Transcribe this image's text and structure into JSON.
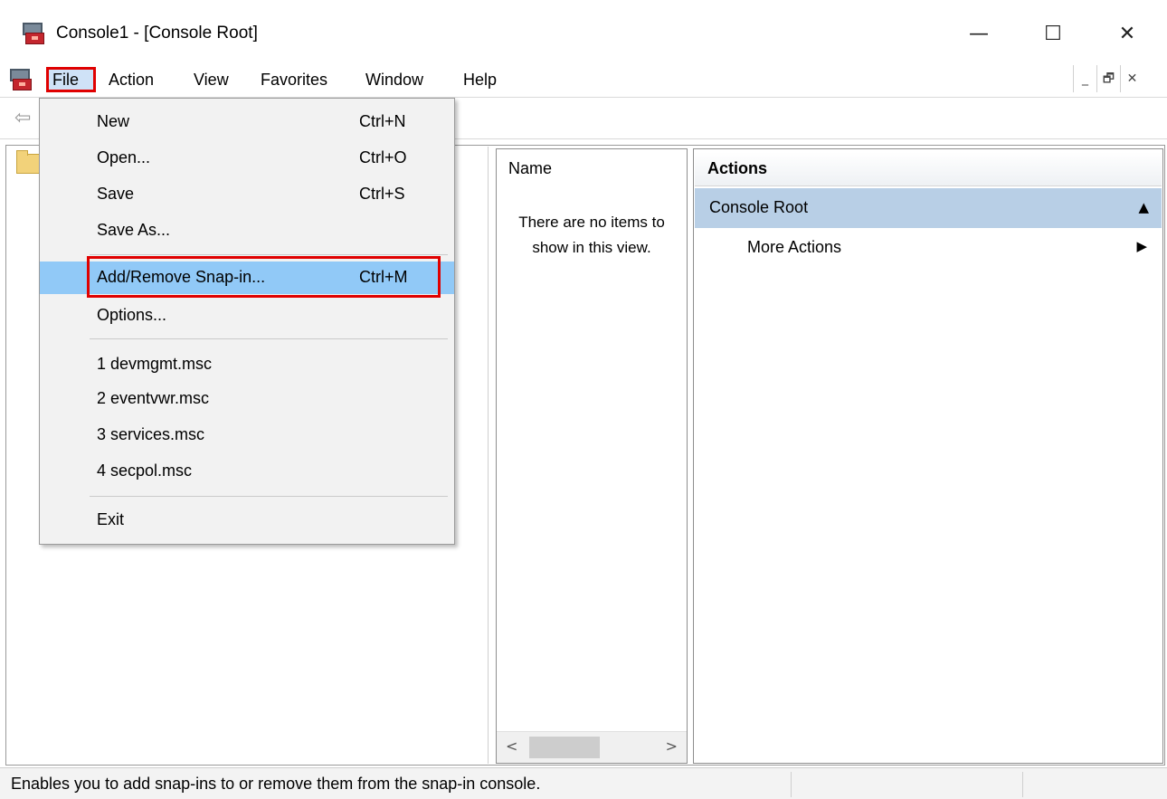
{
  "window": {
    "title": "Console1 - [Console Root]",
    "minimize_glyph": "—",
    "maximize_glyph": "☐",
    "close_glyph": "✕"
  },
  "menubar": {
    "items": [
      "File",
      "Action",
      "View",
      "Favorites",
      "Window",
      "Help"
    ],
    "mdi_buttons": [
      "_",
      "🗗",
      "✕"
    ]
  },
  "toolbar": {
    "back_icon": "⇦"
  },
  "file_menu": {
    "items": [
      {
        "label": "New",
        "shortcut": "Ctrl+N"
      },
      {
        "label": "Open...",
        "shortcut": "Ctrl+O"
      },
      {
        "label": "Save",
        "shortcut": "Ctrl+S"
      },
      {
        "label": "Save As...",
        "shortcut": ""
      },
      {
        "label": "Add/Remove Snap-in...",
        "shortcut": "Ctrl+M",
        "highlighted": true
      },
      {
        "label": "Options...",
        "shortcut": ""
      },
      {
        "label": "1 devmgmt.msc",
        "shortcut": ""
      },
      {
        "label": "2 eventvwr.msc",
        "shortcut": ""
      },
      {
        "label": "3 services.msc",
        "shortcut": ""
      },
      {
        "label": "4 secpol.msc",
        "shortcut": ""
      },
      {
        "label": "Exit",
        "shortcut": ""
      }
    ]
  },
  "list_pane": {
    "column_header": "Name",
    "empty_line1": "There are no items to",
    "empty_line2": "show in this view.",
    "scroll_left": "<",
    "scroll_right": ">"
  },
  "actions_pane": {
    "header": "Actions",
    "section": "Console Root",
    "section_glyph": "▲",
    "more_actions": "More Actions",
    "more_glyph": "▶"
  },
  "statusbar": {
    "text": "Enables you to add snap-ins to or remove them from the snap-in console."
  },
  "colors": {
    "menu_highlight": "#91c9f7",
    "annotation_red": "#e00000",
    "actions_section": "#b8cfe6"
  }
}
